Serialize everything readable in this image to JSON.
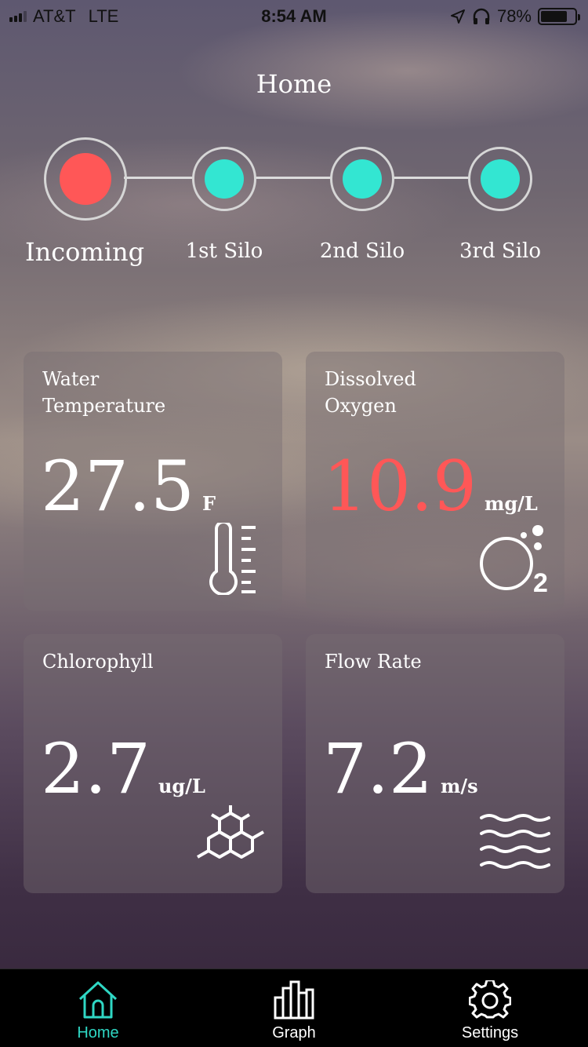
{
  "status_bar": {
    "carrier": "AT&T",
    "network": "LTE",
    "time": "8:54 AM",
    "battery": "78%",
    "battery_level": 0.78
  },
  "page": {
    "title": "Home"
  },
  "stepper": {
    "steps": [
      {
        "label": "Incoming",
        "status_color": "#ff5757"
      },
      {
        "label": "1st Silo",
        "status_color": "#33e6d2"
      },
      {
        "label": "2nd Silo",
        "status_color": "#33e6d2"
      },
      {
        "label": "3rd Silo",
        "status_color": "#33e6d2"
      }
    ]
  },
  "metrics": [
    {
      "title": "Water Temperature",
      "title_lines": [
        "Water",
        "Temperature"
      ],
      "value": "27.5",
      "unit": "F",
      "value_color": "#ffffff",
      "icon": "thermometer-icon"
    },
    {
      "title": "Dissolved Oxygen",
      "title_lines": [
        "Dissolved",
        "Oxygen"
      ],
      "value": "10.9",
      "unit": "mg/L",
      "value_color": "#ff5757",
      "icon": "oxygen-icon"
    },
    {
      "title": "Chlorophyll",
      "title_lines": [
        "Chlorophyll"
      ],
      "value": "2.7",
      "unit": "ug/L",
      "value_color": "#ffffff",
      "icon": "molecule-icon"
    },
    {
      "title": "Flow Rate",
      "title_lines": [
        "Flow Rate"
      ],
      "value": "7.2",
      "unit": "m/s",
      "value_color": "#ffffff",
      "icon": "waves-icon"
    }
  ],
  "tab_bar": {
    "active_color": "#2fd7c4",
    "tabs": [
      {
        "label": "Home",
        "icon": "home-icon",
        "active": true
      },
      {
        "label": "Graph",
        "icon": "bar-chart-icon",
        "active": false
      },
      {
        "label": "Settings",
        "icon": "gear-icon",
        "active": false
      }
    ]
  }
}
